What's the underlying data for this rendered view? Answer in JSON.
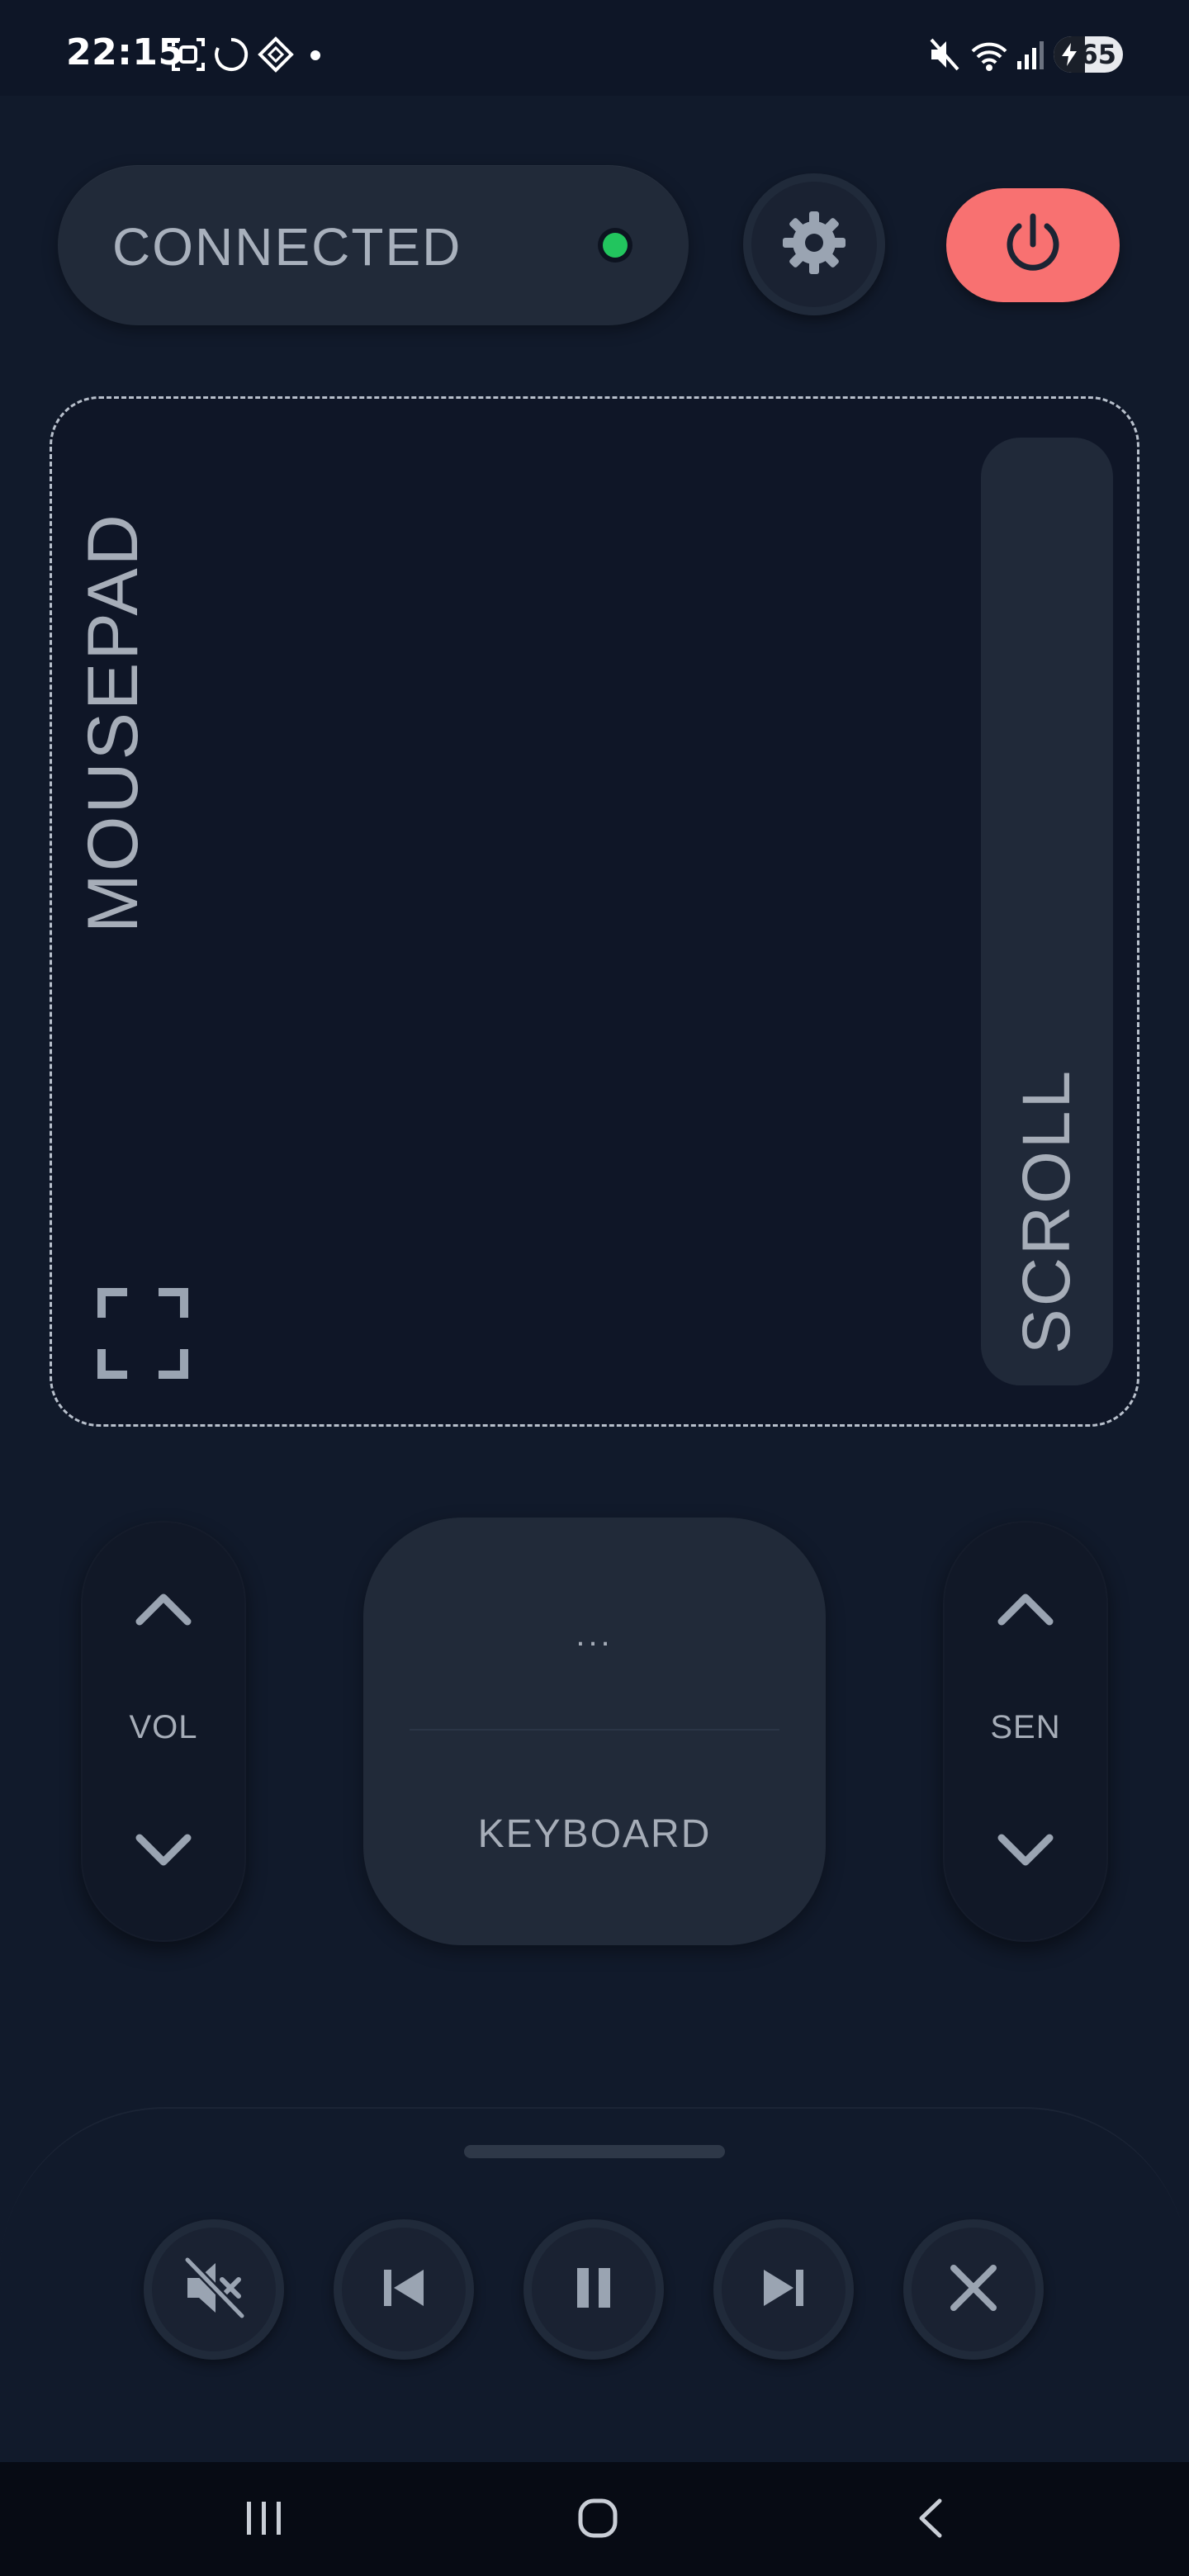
{
  "status_bar": {
    "time": "22:15",
    "battery_level": "65",
    "icons": [
      "screenshot-icon",
      "sync-circle-icon",
      "app-diamond-icon",
      "notification-dot-icon",
      "mute-icon",
      "wifi-icon",
      "signal-icon",
      "battery-icon"
    ]
  },
  "header": {
    "connection_status": "CONNECTED",
    "status_color": "#22c55e",
    "settings_icon": "gear-icon",
    "power_icon": "power-icon",
    "power_color": "#f87171"
  },
  "mousepad": {
    "label": "MOUSEPAD",
    "scroll_label": "SCROLL",
    "fullscreen_icon": "fullscreen-icon"
  },
  "controls": {
    "volume_label": "VOL",
    "sensitivity_label": "SEN",
    "keyboard_preview": "...",
    "keyboard_label": "KEYBOARD"
  },
  "media": {
    "buttons": [
      "mute-icon",
      "previous-track-icon",
      "pause-icon",
      "next-track-icon",
      "close-icon"
    ]
  },
  "nav_bar": {
    "buttons": [
      "recents-icon",
      "home-icon",
      "back-icon"
    ]
  },
  "colors": {
    "background": "#111a2b",
    "panel": "#212a39",
    "text": "#a6adb8"
  }
}
